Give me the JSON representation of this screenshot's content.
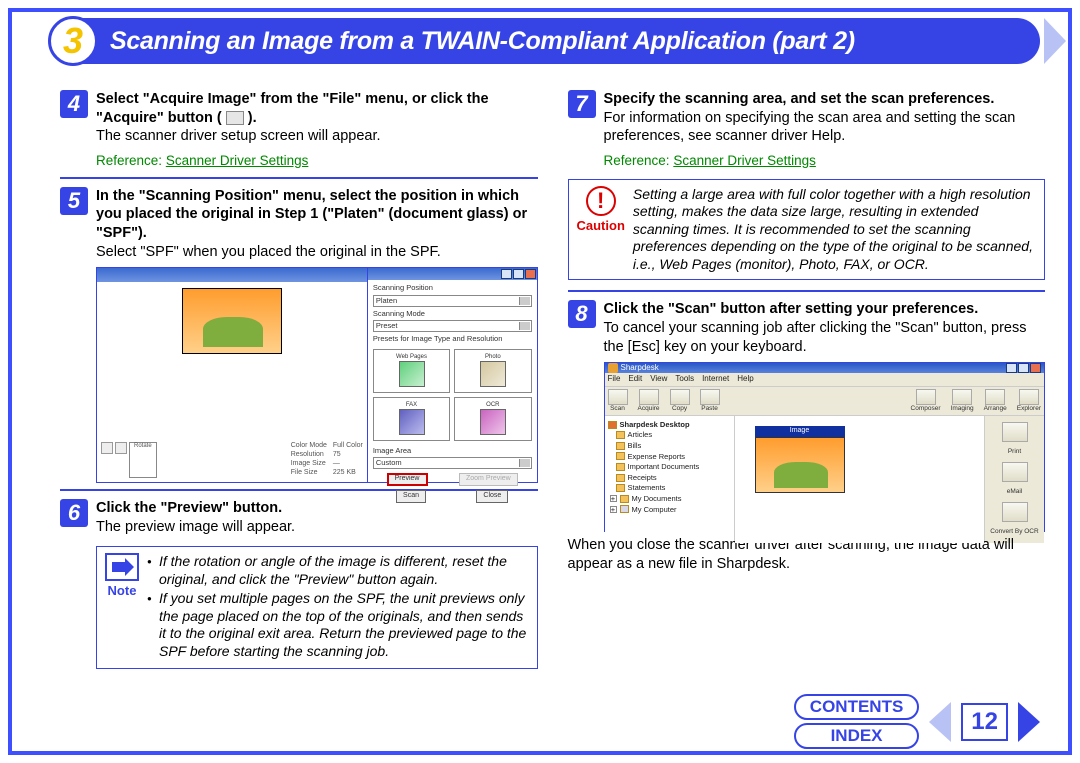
{
  "title": {
    "num": "3",
    "text": "Scanning an Image from a TWAIN-Compliant Application (part 2)"
  },
  "left": {
    "step4": {
      "num": "4",
      "bold1": "Select \"Acquire Image\" from the \"File\" menu, or click the \"Acquire\" button (",
      "bold2": ").",
      "body2": "The scanner driver setup screen will appear.",
      "reflabel": "Reference:",
      "reflink": "Scanner Driver Settings"
    },
    "step5": {
      "num": "5",
      "bold": "In the \"Scanning Position\" menu, select the position in which you placed the original in Step 1 (\"Platen\" (document glass) or \"SPF\").",
      "body": "Select \"SPF\" when you placed the original in the SPF.",
      "panel": {
        "lbl_scanpos": "Scanning Position",
        "dd_scanpos": "Platen",
        "lbl_scanmode": "Scanning Mode",
        "dd_scanmode": "Preset",
        "lbl_presets": "Presets for Image Type and Resolution",
        "p1": "Web Pages",
        "p2": "Photo",
        "p3": "FAX",
        "p4": "OCR",
        "lbl_area": "Image Area",
        "dd_area": "Custom",
        "btn_preview": "Preview",
        "btn_zoom": "Zoom Preview",
        "btn_scan": "Scan",
        "btn_close": "Close",
        "info_lines": "Color Mode\nResolution\nImage Size\nFile Size",
        "info_vals": "Full Color\n75\n—\n225 KB",
        "btn_rotate": "Rotate",
        "lbl_imgsize": "Image Size"
      }
    },
    "step6": {
      "num": "6",
      "bold": "Click the \"Preview\" button.",
      "body": "The preview image will appear."
    },
    "note": {
      "label": "Note",
      "b1": "If the rotation or angle of the image is different, reset the original, and click the \"Preview\" button again.",
      "b2": "If you set multiple pages on the SPF, the unit previews only the page placed on the top of the originals, and then sends it to the original exit area. Return the previewed page to the SPF before starting the scanning job."
    }
  },
  "right": {
    "step7": {
      "num": "7",
      "bold": "Specify the scanning area, and set the scan preferences.",
      "body": "For information on specifying the scan area and setting the scan preferences, see scanner driver Help.",
      "reflabel": "Reference:",
      "reflink": "Scanner Driver Settings"
    },
    "caution": {
      "label": "Caution",
      "text": "Setting a large area with full color together with a high resolution setting, makes the data size large, resulting in extended scanning times. It is recommended to set the scanning preferences depending on the type of the original to be scanned, i.e., Web Pages (monitor), Photo, FAX, or OCR."
    },
    "step8": {
      "num": "8",
      "bold": "Click the \"Scan\" button after setting your preferences.",
      "body": "To cancel your scanning job after clicking the \"Scan\" button, press the [Esc] key on your keyboard.",
      "closing": "When you close the scanner driver after scanning, the image data will appear as a new file in Sharpdesk."
    },
    "sharpdesk": {
      "title": "Sharpdesk",
      "menu": [
        "File",
        "Edit",
        "View",
        "Tools",
        "Internet",
        "Help"
      ],
      "tools": [
        "Scan",
        "Acquire",
        "Copy",
        "Paste",
        "Composer",
        "Imaging",
        "Arrange",
        "Explorer"
      ],
      "tree_root": "Sharpdesk Desktop",
      "tree": [
        "Articles",
        "Bills",
        "Expense Reports",
        "Important Documents",
        "Receipts",
        "Statements",
        "My Documents"
      ],
      "tree_comp": "My Computer",
      "thumb_label": "Image",
      "side": [
        "Print",
        "eMail",
        "Convert By OCR"
      ]
    }
  },
  "nav": {
    "contents": "CONTENTS",
    "index": "INDEX",
    "page": "12"
  }
}
